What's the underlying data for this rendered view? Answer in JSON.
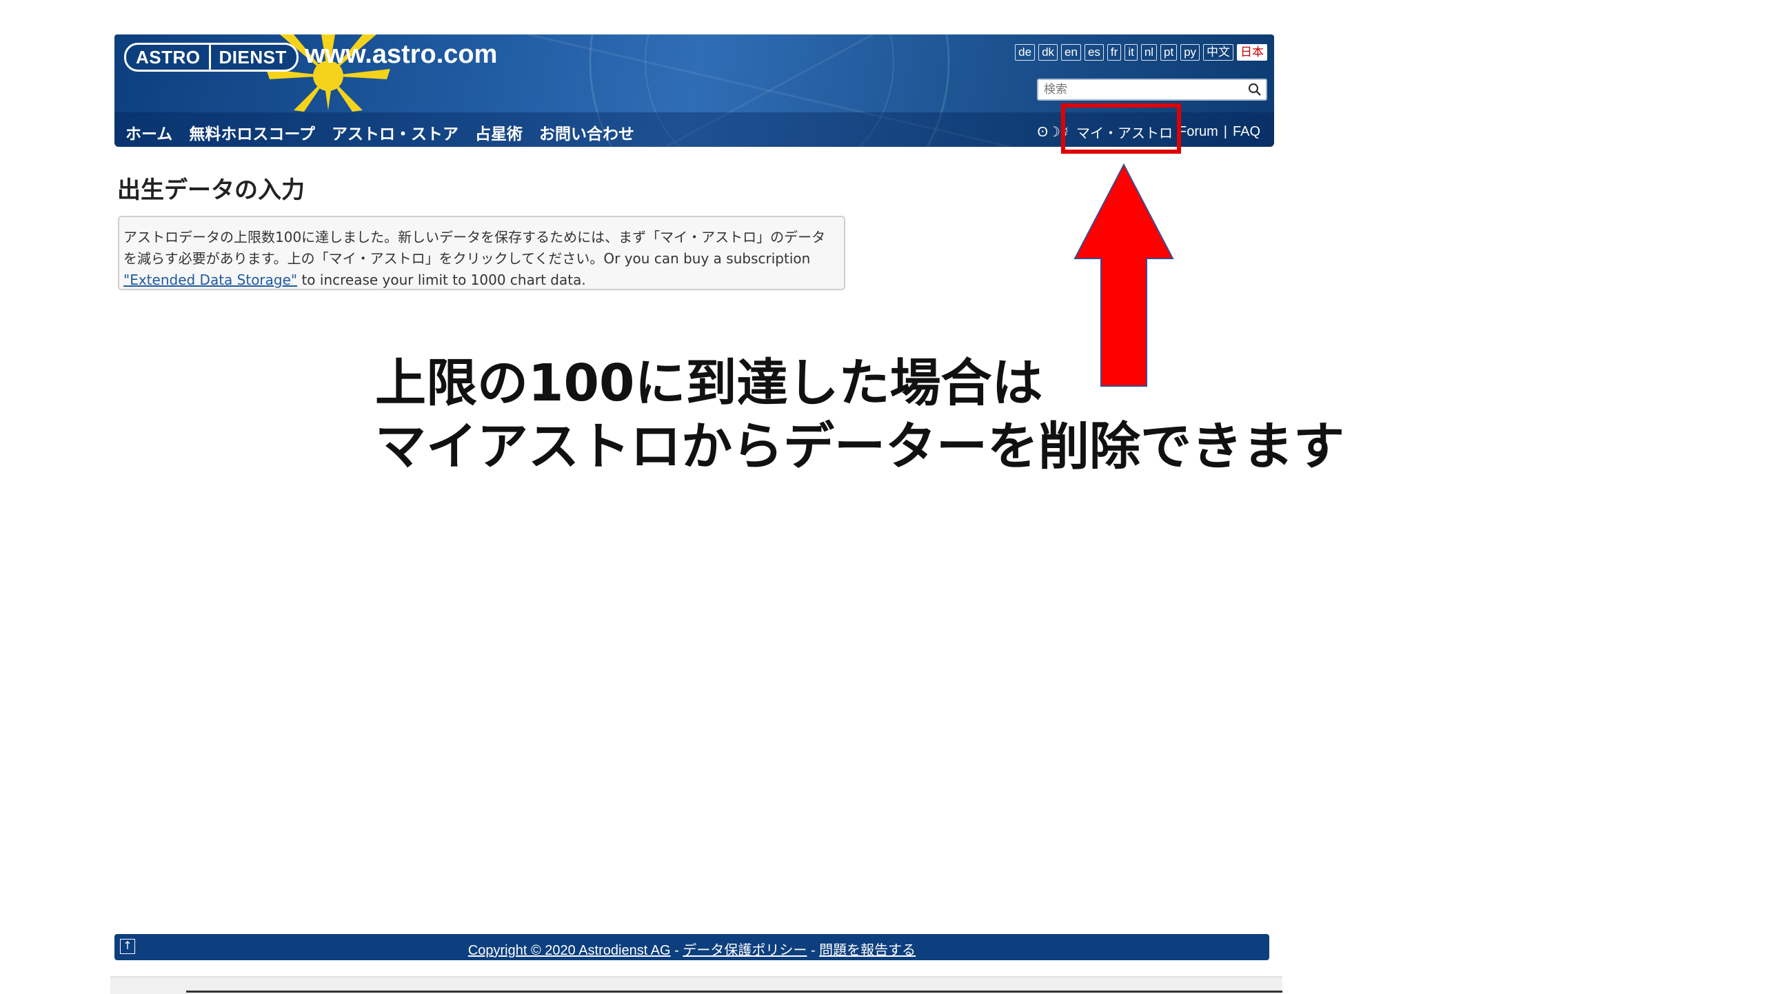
{
  "header": {
    "logo_left": "ASTRO",
    "logo_right": "DIENST",
    "site_url": "www.astro.com",
    "languages": [
      "de",
      "dk",
      "en",
      "es",
      "fr",
      "it",
      "nl",
      "pt",
      "ру",
      "中文",
      "日本"
    ],
    "active_language": "日本",
    "search_placeholder": "検索"
  },
  "nav": {
    "items": [
      "ホーム",
      "無料ホロスコープ",
      "アストロ・ストア",
      "占星術",
      "お問い合わせ"
    ],
    "right_prefix": "ʘ☽☿",
    "my_astro": "マイ・アストロ",
    "forum": "Forum",
    "separator": "|",
    "faq": "FAQ"
  },
  "main": {
    "title": "出生データの入力",
    "notice_line1": "アストロデータの上限数100に達しました。新しいデータを保存するためには、まず「マイ・アストロ」のデータ",
    "notice_line2": "を減らす必要があります。上の「マイ・アストロ」をクリックしてください。Or you can buy a subscription",
    "notice_link": "\"Extended Data Storage\"",
    "notice_line3_rest": " to increase your limit to 1000 chart data."
  },
  "annotation": {
    "line1": "上限の100に到達した場合は",
    "line2": "マイアストロからデーターを削除できます",
    "highlight_color": "#e00000",
    "arrow_color": "#ff0000"
  },
  "footer": {
    "copyright": "Copyright © 2020 Astrodienst AG",
    "sep": " - ",
    "privacy": "データ保護ポリシー",
    "report": "問題を報告する"
  }
}
